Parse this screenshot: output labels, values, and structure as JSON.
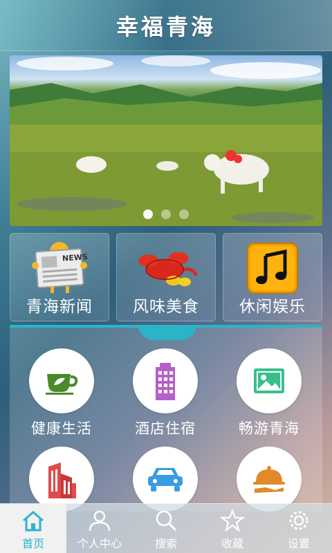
{
  "header": {
    "title": "幸福青海"
  },
  "banner": {
    "dots": 3,
    "active_dot": 0
  },
  "categories": [
    {
      "label": "青海新闻",
      "icon": "newspaper-icon"
    },
    {
      "label": "风味美食",
      "icon": "lobster-icon"
    },
    {
      "label": "休闲娱乐",
      "icon": "music-note-icon"
    }
  ],
  "services": [
    {
      "label": "健康生活",
      "icon": "tea-cup-icon",
      "color": "#4a8a2a"
    },
    {
      "label": "酒店住宿",
      "icon": "hotel-building-icon",
      "color": "#b560c8"
    },
    {
      "label": "畅游青海",
      "icon": "image-landscape-icon",
      "color": "#39c08a"
    },
    {
      "label": "",
      "icon": "city-buildings-icon",
      "color": "#e04a4a"
    },
    {
      "label": "",
      "icon": "car-icon",
      "color": "#3a9be0"
    },
    {
      "label": "",
      "icon": "food-cloche-icon",
      "color": "#e08a2a"
    }
  ],
  "tabbar": {
    "items": [
      {
        "label": "首页",
        "icon": "home-icon"
      },
      {
        "label": "个人中心",
        "icon": "user-icon"
      },
      {
        "label": "搜索",
        "icon": "search-icon"
      },
      {
        "label": "收藏",
        "icon": "star-icon"
      },
      {
        "label": "设置",
        "icon": "gear-icon"
      }
    ],
    "active": 0
  },
  "colors": {
    "accent": "#29b3d1",
    "panel_border": "#2bb4c8"
  }
}
